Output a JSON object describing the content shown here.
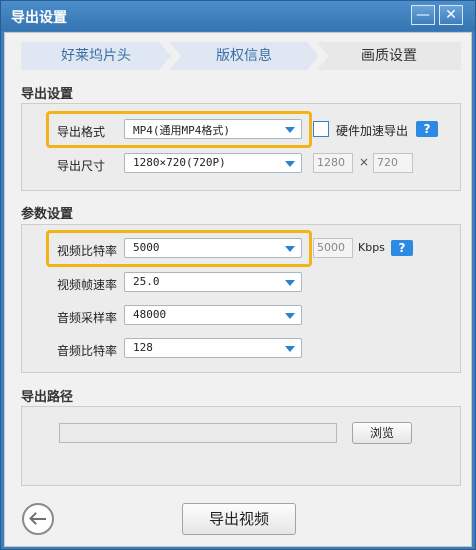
{
  "window": {
    "title": "导出设置",
    "minimize": "—",
    "close": "✕"
  },
  "steps": [
    "好莱坞片头",
    "版权信息",
    "画质设置"
  ],
  "export_settings": {
    "title": "导出设置",
    "format_label": "导出格式",
    "format_value": "MP4(通用MP4格式)",
    "hw_accel_label": "硬件加速导出",
    "size_label": "导出尺寸",
    "size_value": "1280×720(720P)",
    "width": "1280",
    "times": "×",
    "height": "720"
  },
  "param_settings": {
    "title": "参数设置",
    "video_bitrate_label": "视频比特率",
    "video_bitrate_value": "5000",
    "video_bitrate_custom": "5000",
    "kbps": "Kbps",
    "framerate_label": "视频帧速率",
    "framerate_value": "25.0",
    "samplerate_label": "音频采样率",
    "samplerate_value": "48000",
    "audio_bitrate_label": "音频比特率",
    "audio_bitrate_value": "128"
  },
  "export_path": {
    "title": "导出路径",
    "path_value": "",
    "browse_label": "浏览"
  },
  "footer": {
    "export_video_label": "导出视频"
  },
  "help": "?",
  "colors": {
    "accent": "#2d8ae3",
    "highlight": "#f2b318",
    "titlebar": "#3c7fbd"
  },
  "icons": {
    "back": "back-arrow-icon",
    "dropdown": "chevron-down-icon"
  }
}
